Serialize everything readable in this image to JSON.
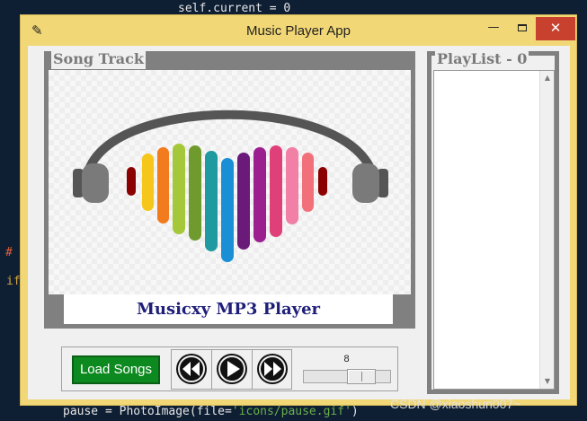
{
  "background_code": {
    "top_line": "self.current = 0",
    "bottom_line_prefix": "pause = PhotoImage(file=",
    "bottom_line_string": "'icons/pause.gif'",
    "bottom_line_suffix": ")",
    "hash_fragment": "#",
    "if_fragment": "if"
  },
  "window": {
    "title": "Music Player App",
    "app_icon": "feather-icon",
    "controls": {
      "minimize": "—",
      "close": "✕"
    }
  },
  "song_track": {
    "frame_label": "Song Track",
    "caption": "Musicxy MP3 Player"
  },
  "playlist": {
    "frame_label": "PlayList - 0",
    "items": []
  },
  "controls": {
    "load_label": "Load Songs",
    "buttons": [
      "rewind-icon",
      "play-icon",
      "fast-forward-icon"
    ],
    "volume": {
      "value": 8,
      "label": "8"
    }
  },
  "watermark": "CSDN @xiaoshun007~",
  "colors": {
    "window_frame": "#f1d775",
    "close_button": "#c8412e",
    "load_button": "#0d8a1f",
    "caption_text": "#1f1f7a",
    "frame_border": "#808080"
  }
}
